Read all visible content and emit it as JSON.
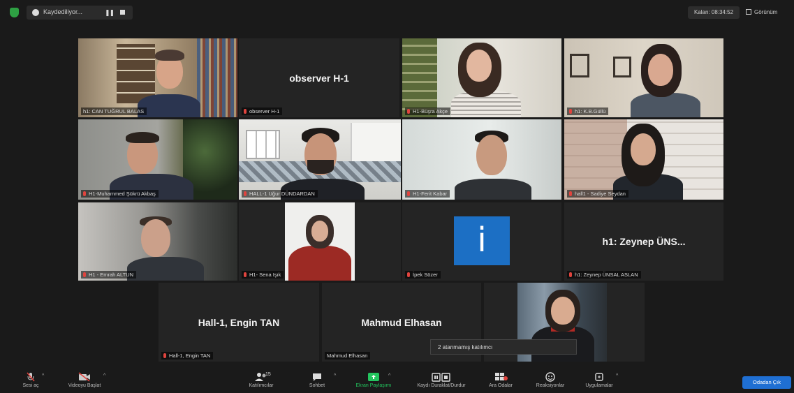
{
  "topbar": {
    "recording_label": "Kaydediliyor...",
    "pause_glyph": "❚❚",
    "timer": "Kalan: 08:34:52",
    "view_label": "Görünüm",
    "shield_color": "#2ea043"
  },
  "participants": [
    {
      "name": "h1: CAN TUĞRUL BALAS",
      "big_name": ""
    },
    {
      "name": "observer H-1",
      "big_name": "observer H-1"
    },
    {
      "name": "H1-Büşra Akçe",
      "big_name": ""
    },
    {
      "name": "h1: K.B.Güllü",
      "big_name": ""
    },
    {
      "name": "H1-Muhammed Şükrü Akbaş",
      "big_name": ""
    },
    {
      "name": "HALL-1 Uğur DÜNDARDAN",
      "big_name": ""
    },
    {
      "name": "H1-Ferit Kabar",
      "big_name": ""
    },
    {
      "name": "hall1 - Sadiye Seydan",
      "big_name": ""
    },
    {
      "name": "H1 - Emrah ALTUN",
      "big_name": ""
    },
    {
      "name": "H1- Sena Işık",
      "big_name": ""
    },
    {
      "name": "İpek Sözer",
      "big_name": ""
    },
    {
      "name": "h1: Zeynep ÜNSAL ASLAN",
      "big_name": "h1: Zeynep ÜNS..."
    },
    {
      "name": "Hall-1, Engin TAN",
      "big_name": "Hall-1, Engin TAN"
    },
    {
      "name": "Mahmud Elhasan",
      "big_name": "Mahmud Elhasan"
    },
    {
      "name": "",
      "big_name": ""
    }
  ],
  "ipek_initial": "i",
  "tooltip": "2 atanmamış katılımcı",
  "toolbar": {
    "mute": "Sesi aç",
    "video": "Videoyu Başlat",
    "participants": "Katılımcılar",
    "participants_count": "15",
    "chat": "Sohbet",
    "share": "Ekran Paylaşımı",
    "record": "Kaydı Duraklat/Durdur",
    "breakout": "Ara Odalar",
    "reactions": "Reaksiyonlar",
    "apps": "Uygulamalar",
    "leave": "Odadan Çık",
    "accent": "#1f6fd3",
    "share_green": "#23c55e"
  }
}
